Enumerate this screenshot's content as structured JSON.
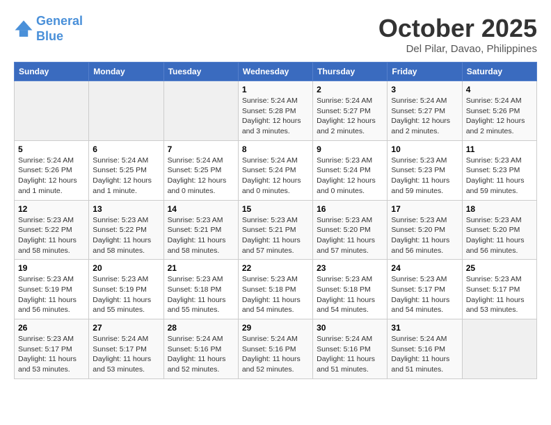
{
  "header": {
    "logo_line1": "General",
    "logo_line2": "Blue",
    "month": "October 2025",
    "location": "Del Pilar, Davao, Philippines"
  },
  "weekdays": [
    "Sunday",
    "Monday",
    "Tuesday",
    "Wednesday",
    "Thursday",
    "Friday",
    "Saturday"
  ],
  "weeks": [
    [
      {
        "day": "",
        "info": ""
      },
      {
        "day": "",
        "info": ""
      },
      {
        "day": "",
        "info": ""
      },
      {
        "day": "1",
        "info": "Sunrise: 5:24 AM\nSunset: 5:28 PM\nDaylight: 12 hours\nand 3 minutes."
      },
      {
        "day": "2",
        "info": "Sunrise: 5:24 AM\nSunset: 5:27 PM\nDaylight: 12 hours\nand 2 minutes."
      },
      {
        "day": "3",
        "info": "Sunrise: 5:24 AM\nSunset: 5:27 PM\nDaylight: 12 hours\nand 2 minutes."
      },
      {
        "day": "4",
        "info": "Sunrise: 5:24 AM\nSunset: 5:26 PM\nDaylight: 12 hours\nand 2 minutes."
      }
    ],
    [
      {
        "day": "5",
        "info": "Sunrise: 5:24 AM\nSunset: 5:26 PM\nDaylight: 12 hours\nand 1 minute."
      },
      {
        "day": "6",
        "info": "Sunrise: 5:24 AM\nSunset: 5:25 PM\nDaylight: 12 hours\nand 1 minute."
      },
      {
        "day": "7",
        "info": "Sunrise: 5:24 AM\nSunset: 5:25 PM\nDaylight: 12 hours\nand 0 minutes."
      },
      {
        "day": "8",
        "info": "Sunrise: 5:24 AM\nSunset: 5:24 PM\nDaylight: 12 hours\nand 0 minutes."
      },
      {
        "day": "9",
        "info": "Sunrise: 5:23 AM\nSunset: 5:24 PM\nDaylight: 12 hours\nand 0 minutes."
      },
      {
        "day": "10",
        "info": "Sunrise: 5:23 AM\nSunset: 5:23 PM\nDaylight: 11 hours\nand 59 minutes."
      },
      {
        "day": "11",
        "info": "Sunrise: 5:23 AM\nSunset: 5:23 PM\nDaylight: 11 hours\nand 59 minutes."
      }
    ],
    [
      {
        "day": "12",
        "info": "Sunrise: 5:23 AM\nSunset: 5:22 PM\nDaylight: 11 hours\nand 58 minutes."
      },
      {
        "day": "13",
        "info": "Sunrise: 5:23 AM\nSunset: 5:22 PM\nDaylight: 11 hours\nand 58 minutes."
      },
      {
        "day": "14",
        "info": "Sunrise: 5:23 AM\nSunset: 5:21 PM\nDaylight: 11 hours\nand 58 minutes."
      },
      {
        "day": "15",
        "info": "Sunrise: 5:23 AM\nSunset: 5:21 PM\nDaylight: 11 hours\nand 57 minutes."
      },
      {
        "day": "16",
        "info": "Sunrise: 5:23 AM\nSunset: 5:20 PM\nDaylight: 11 hours\nand 57 minutes."
      },
      {
        "day": "17",
        "info": "Sunrise: 5:23 AM\nSunset: 5:20 PM\nDaylight: 11 hours\nand 56 minutes."
      },
      {
        "day": "18",
        "info": "Sunrise: 5:23 AM\nSunset: 5:20 PM\nDaylight: 11 hours\nand 56 minutes."
      }
    ],
    [
      {
        "day": "19",
        "info": "Sunrise: 5:23 AM\nSunset: 5:19 PM\nDaylight: 11 hours\nand 56 minutes."
      },
      {
        "day": "20",
        "info": "Sunrise: 5:23 AM\nSunset: 5:19 PM\nDaylight: 11 hours\nand 55 minutes."
      },
      {
        "day": "21",
        "info": "Sunrise: 5:23 AM\nSunset: 5:18 PM\nDaylight: 11 hours\nand 55 minutes."
      },
      {
        "day": "22",
        "info": "Sunrise: 5:23 AM\nSunset: 5:18 PM\nDaylight: 11 hours\nand 54 minutes."
      },
      {
        "day": "23",
        "info": "Sunrise: 5:23 AM\nSunset: 5:18 PM\nDaylight: 11 hours\nand 54 minutes."
      },
      {
        "day": "24",
        "info": "Sunrise: 5:23 AM\nSunset: 5:17 PM\nDaylight: 11 hours\nand 54 minutes."
      },
      {
        "day": "25",
        "info": "Sunrise: 5:23 AM\nSunset: 5:17 PM\nDaylight: 11 hours\nand 53 minutes."
      }
    ],
    [
      {
        "day": "26",
        "info": "Sunrise: 5:23 AM\nSunset: 5:17 PM\nDaylight: 11 hours\nand 53 minutes."
      },
      {
        "day": "27",
        "info": "Sunrise: 5:24 AM\nSunset: 5:17 PM\nDaylight: 11 hours\nand 53 minutes."
      },
      {
        "day": "28",
        "info": "Sunrise: 5:24 AM\nSunset: 5:16 PM\nDaylight: 11 hours\nand 52 minutes."
      },
      {
        "day": "29",
        "info": "Sunrise: 5:24 AM\nSunset: 5:16 PM\nDaylight: 11 hours\nand 52 minutes."
      },
      {
        "day": "30",
        "info": "Sunrise: 5:24 AM\nSunset: 5:16 PM\nDaylight: 11 hours\nand 51 minutes."
      },
      {
        "day": "31",
        "info": "Sunrise: 5:24 AM\nSunset: 5:16 PM\nDaylight: 11 hours\nand 51 minutes."
      },
      {
        "day": "",
        "info": ""
      }
    ]
  ]
}
